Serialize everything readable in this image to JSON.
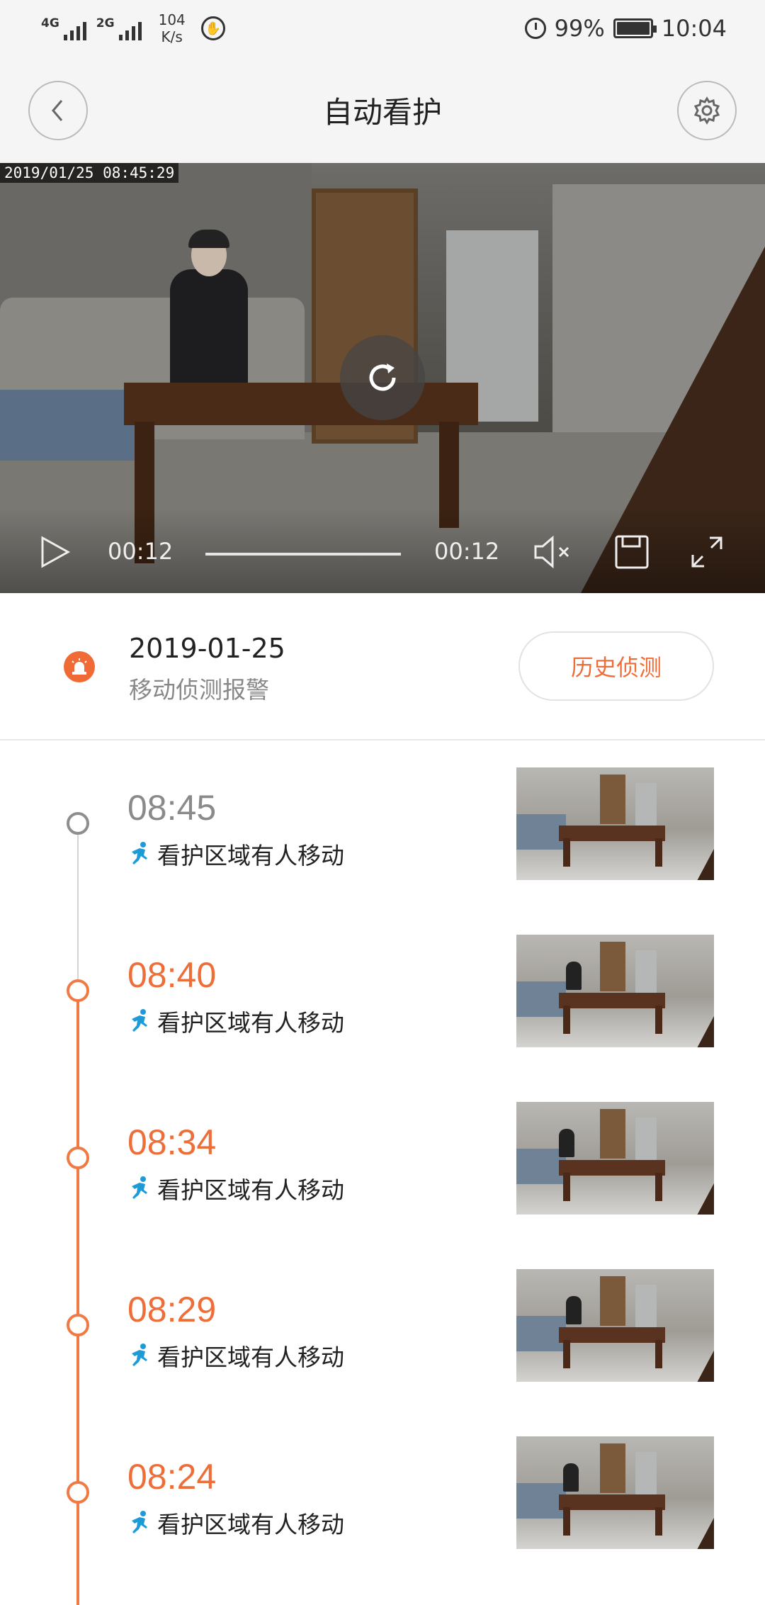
{
  "status_bar": {
    "net1": "4G",
    "net2": "2G",
    "speed_value": "104",
    "speed_unit": "K/s",
    "battery": "99%",
    "time": "10:04"
  },
  "nav": {
    "title": "自动看护"
  },
  "video": {
    "timestamp": "2019/01/25  08:45:29",
    "current_time": "00:12",
    "total_time": "00:12",
    "progress": 1.0
  },
  "alert": {
    "date": "2019-01-25",
    "subtitle": "移动侦测报警",
    "history_button": "历史侦测"
  },
  "events": [
    {
      "time": "08:45",
      "description": "看护区域有人移动",
      "state": "viewed"
    },
    {
      "time": "08:40",
      "description": "看护区域有人移动",
      "state": "new"
    },
    {
      "time": "08:34",
      "description": "看护区域有人移动",
      "state": "new"
    },
    {
      "time": "08:29",
      "description": "看护区域有人移动",
      "state": "new"
    },
    {
      "time": "08:24",
      "description": "看护区域有人移动",
      "state": "new"
    }
  ],
  "colors": {
    "accent": "#ee6e3a",
    "timeline_orange": "#ef7a44",
    "viewed_grey": "#8a8a8a",
    "running_icon": "#1e9bd7"
  }
}
